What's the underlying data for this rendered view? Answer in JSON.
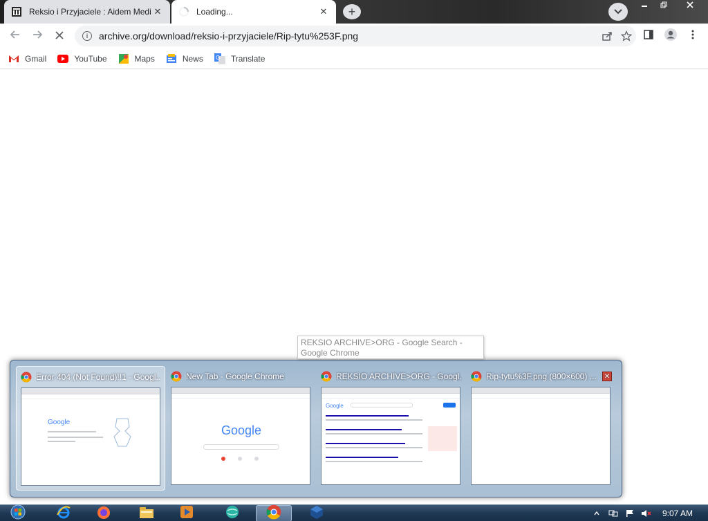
{
  "tabs": [
    {
      "title": "Reksio i Przyjaciele : Aidem Medi",
      "icon": "archive-org-icon",
      "state": "inactive"
    },
    {
      "title": "Loading...",
      "icon": "loading-spinner-icon",
      "state": "active"
    }
  ],
  "new_tab_symbol": "+",
  "tab_close_symbol": "✕",
  "toolbar": {
    "url": "archive.org/download/reksio-i-przyjaciele/Rip-tytu%253F.png",
    "info_symbol": "i"
  },
  "bookmarks": [
    {
      "label": "Gmail",
      "icon": "gmail-icon",
      "color": "#d93025"
    },
    {
      "label": "YouTube",
      "icon": "youtube-icon",
      "color": "#ff0000"
    },
    {
      "label": "Maps",
      "icon": "maps-icon",
      "color": "#34a853"
    },
    {
      "label": "News",
      "icon": "news-icon",
      "color": "#4285f4"
    },
    {
      "label": "Translate",
      "icon": "translate-icon",
      "color": "#4285f4"
    }
  ],
  "tooltip": {
    "text": "REKSIO ARCHIVE>ORG - Google Search - Google Chrome"
  },
  "peek_thumbnails": [
    {
      "title": "Error 404 (Not Found)!!1 - Googl...",
      "selected": true
    },
    {
      "title": "New Tab - Google Chrome",
      "selected": false
    },
    {
      "title": "REKSIO ARCHIVE>ORG - Googl...",
      "selected": false
    },
    {
      "title": "Rip-tytu%3F.png (800×600) ...",
      "selected": false
    }
  ],
  "peek_close_symbol": "✕",
  "thumb_text": {
    "google_logo": "Google"
  },
  "taskbar": {
    "items": [
      {
        "icon": "start-orb-icon"
      },
      {
        "icon": "internet-explorer-icon"
      },
      {
        "icon": "firefox-icon"
      },
      {
        "icon": "file-explorer-icon"
      },
      {
        "icon": "media-player-icon"
      },
      {
        "icon": "app-globe-icon"
      },
      {
        "icon": "chrome-icon",
        "active": true
      },
      {
        "icon": "virtualbox-icon"
      }
    ],
    "clock": "9:07 AM"
  },
  "colors": {
    "tab_active": "#ffffff",
    "tab_inactive": "#dfe1e5",
    "omnibox": "#f1f3f4",
    "taskbar": "#1f3853"
  }
}
